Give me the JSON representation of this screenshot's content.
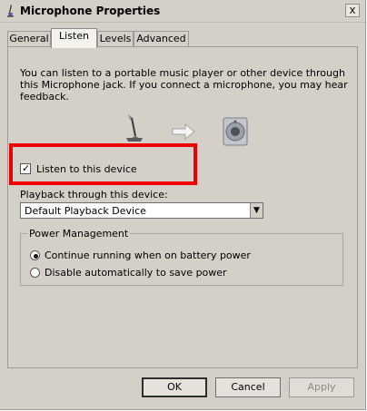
{
  "window": {
    "title": "Microphone Properties",
    "close_glyph": "x"
  },
  "tabs": [
    {
      "label": "General"
    },
    {
      "label": "Listen"
    },
    {
      "label": "Levels"
    },
    {
      "label": "Advanced"
    }
  ],
  "listen": {
    "description_line1": "You can listen to a portable music player or other device through",
    "description_line2": "this Microphone jack.  If you connect a microphone, you may hear",
    "description_line3": "feedback.",
    "checkbox_label": "Listen to this device",
    "checkbox_checked": true,
    "checkbox_mark": "✓",
    "playback_label": "Playback through this device:",
    "playback_value": "Default Playback Device",
    "dropdown_arrow": "▼"
  },
  "power": {
    "group_label": "Power Management",
    "options": [
      {
        "label": "Continue running when on battery power",
        "selected": true
      },
      {
        "label": "Disable automatically to save power",
        "selected": false
      }
    ]
  },
  "buttons": {
    "ok": "OK",
    "cancel": "Cancel",
    "apply": "Apply"
  },
  "colors": {
    "highlight_border": "#ef0000",
    "window_bg": "#d4d0c8"
  },
  "icons": [
    "microphone-icon",
    "arrow-right-icon",
    "speaker-icon"
  ]
}
